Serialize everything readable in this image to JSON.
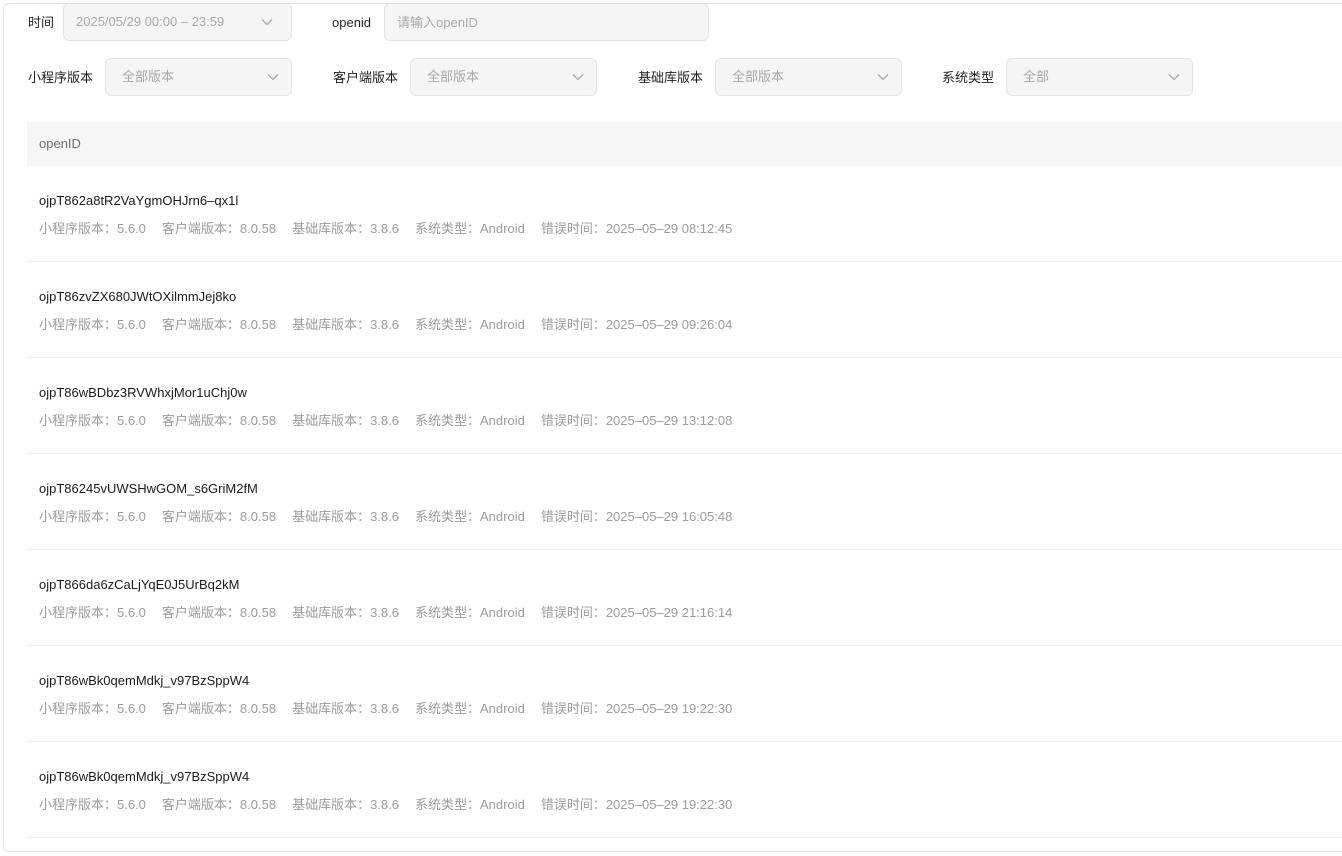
{
  "filters": {
    "time_label": "时间",
    "time_value": "2025/05/29 00:00 – 23:59",
    "openid_label": "openid",
    "openid_placeholder": "请输入openID",
    "miniprogram_version_label": "小程序版本",
    "miniprogram_version_value": "全部版本",
    "client_version_label": "客户端版本",
    "client_version_value": "全部版本",
    "base_lib_version_label": "基础库版本",
    "base_lib_version_value": "全部版本",
    "os_type_label": "系统类型",
    "os_type_value": "全部"
  },
  "table": {
    "header": "openID",
    "rows": [
      {
        "openid": "ojpT862a8tR2VaYgmOHJrn6–qx1l",
        "mp_version": "小程序版本：5.6.0",
        "client_version": "客户端版本：8.0.58",
        "base_version": "基础库版本：3.8.6",
        "os": "系统类型：Android",
        "error_time": "错误时间：2025–05–29 08:12:45"
      },
      {
        "openid": "ojpT86zvZX680JWtOXilmmJej8ko",
        "mp_version": "小程序版本：5.6.0",
        "client_version": "客户端版本：8.0.58",
        "base_version": "基础库版本：3.8.6",
        "os": "系统类型：Android",
        "error_time": "错误时间：2025–05–29 09:26:04"
      },
      {
        "openid": "ojpT86wBDbz3RVWhxjMor1uChj0w",
        "mp_version": "小程序版本：5.6.0",
        "client_version": "客户端版本：8.0.58",
        "base_version": "基础库版本：3.8.6",
        "os": "系统类型：Android",
        "error_time": "错误时间：2025–05–29 13:12:08"
      },
      {
        "openid": "ojpT86245vUWSHwGOM_s6GriM2fM",
        "mp_version": "小程序版本：5.6.0",
        "client_version": "客户端版本：8.0.58",
        "base_version": "基础库版本：3.8.6",
        "os": "系统类型：Android",
        "error_time": "错误时间：2025–05–29 16:05:48"
      },
      {
        "openid": "ojpT866da6zCaLjYqE0J5UrBq2kM",
        "mp_version": "小程序版本：5.6.0",
        "client_version": "客户端版本：8.0.58",
        "base_version": "基础库版本：3.8.6",
        "os": "系统类型：Android",
        "error_time": "错误时间：2025–05–29 21:16:14"
      },
      {
        "openid": "ojpT86wBk0qemMdkj_v97BzSppW4",
        "mp_version": "小程序版本：5.6.0",
        "client_version": "客户端版本：8.0.58",
        "base_version": "基础库版本：3.8.6",
        "os": "系统类型：Android",
        "error_time": "错误时间：2025–05–29 19:22:30"
      },
      {
        "openid": "ojpT86wBk0qemMdkj_v97BzSppW4",
        "mp_version": "小程序版本：5.6.0",
        "client_version": "客户端版本：8.0.58",
        "base_version": "基础库版本：3.8.6",
        "os": "系统类型：Android",
        "error_time": "错误时间：2025–05–29 19:22:30"
      }
    ]
  },
  "icons": {
    "chevron": "chevron-down-icon"
  }
}
